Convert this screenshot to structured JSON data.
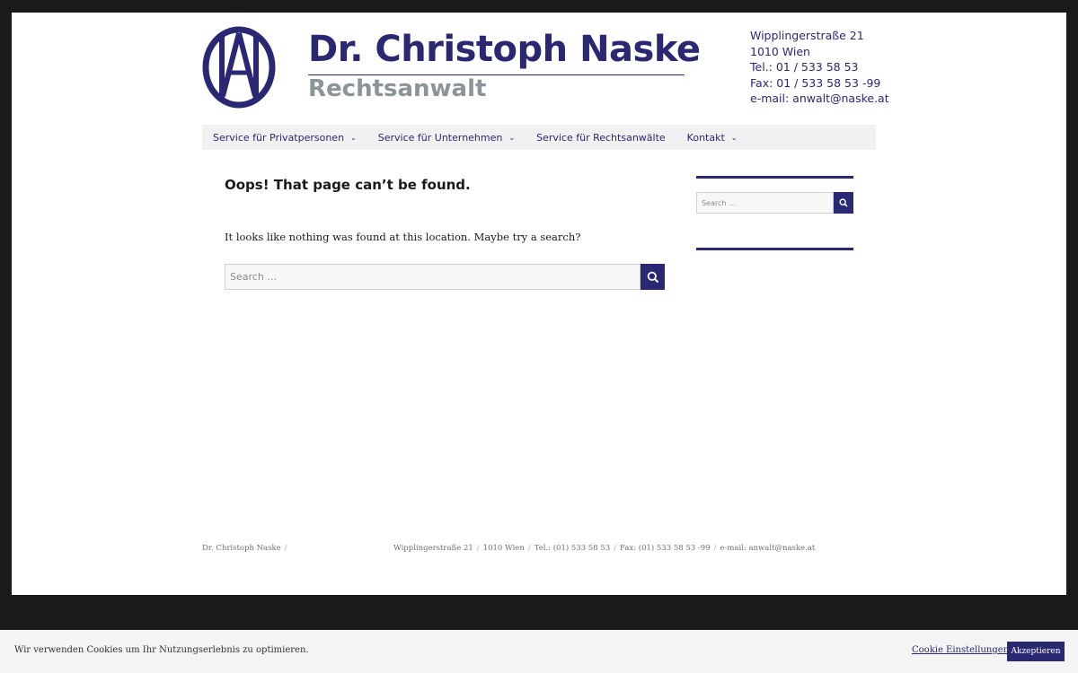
{
  "header": {
    "title": "Dr. Christoph Naske",
    "subtitle": "Rechtsanwalt",
    "logo_icon": "an-monogram-logo",
    "contact": [
      "Wipplingerstraße 21",
      "1010 Wien",
      "Tel.: 01 / 533 58 53",
      "Fax: 01 / 533 58 53 -99",
      "e-mail: anwalt@naske.at"
    ]
  },
  "nav": {
    "items": [
      {
        "label": "Service für Privatpersonen",
        "has_submenu": true
      },
      {
        "label": "Service für Unternehmen",
        "has_submenu": true
      },
      {
        "label": "Service für Rechtsanwälte",
        "has_submenu": false
      },
      {
        "label": "Kontakt",
        "has_submenu": true
      }
    ],
    "chevron": "⌄"
  },
  "main": {
    "heading": "Oops! That page can’t be found.",
    "message": "It looks like nothing was found at this location. Maybe try a search?",
    "search_placeholder": "Search …"
  },
  "sidebar": {
    "search_placeholder": "Search …"
  },
  "footer": {
    "site_name": "Dr. Christoph Naske",
    "items": [
      "Wipplingerstraße 21",
      "1010 Wien",
      "Tel.: (01) 533 58 53",
      "Fax: (01) 533 58 53 -99",
      "e-mail: anwalt@naske.at"
    ]
  },
  "cookie": {
    "text": "Wir verwenden Cookies um Ihr Nutzungserlebnis zu optimieren.",
    "settings_label": "Cookie Einstellungen",
    "accept_label": "Akzeptieren"
  },
  "colors": {
    "brand": "#2a2873",
    "subtitle_gray": "#8a9499",
    "nav_bg": "#f1f1f1",
    "outer_bg": "#1a1a1a"
  }
}
